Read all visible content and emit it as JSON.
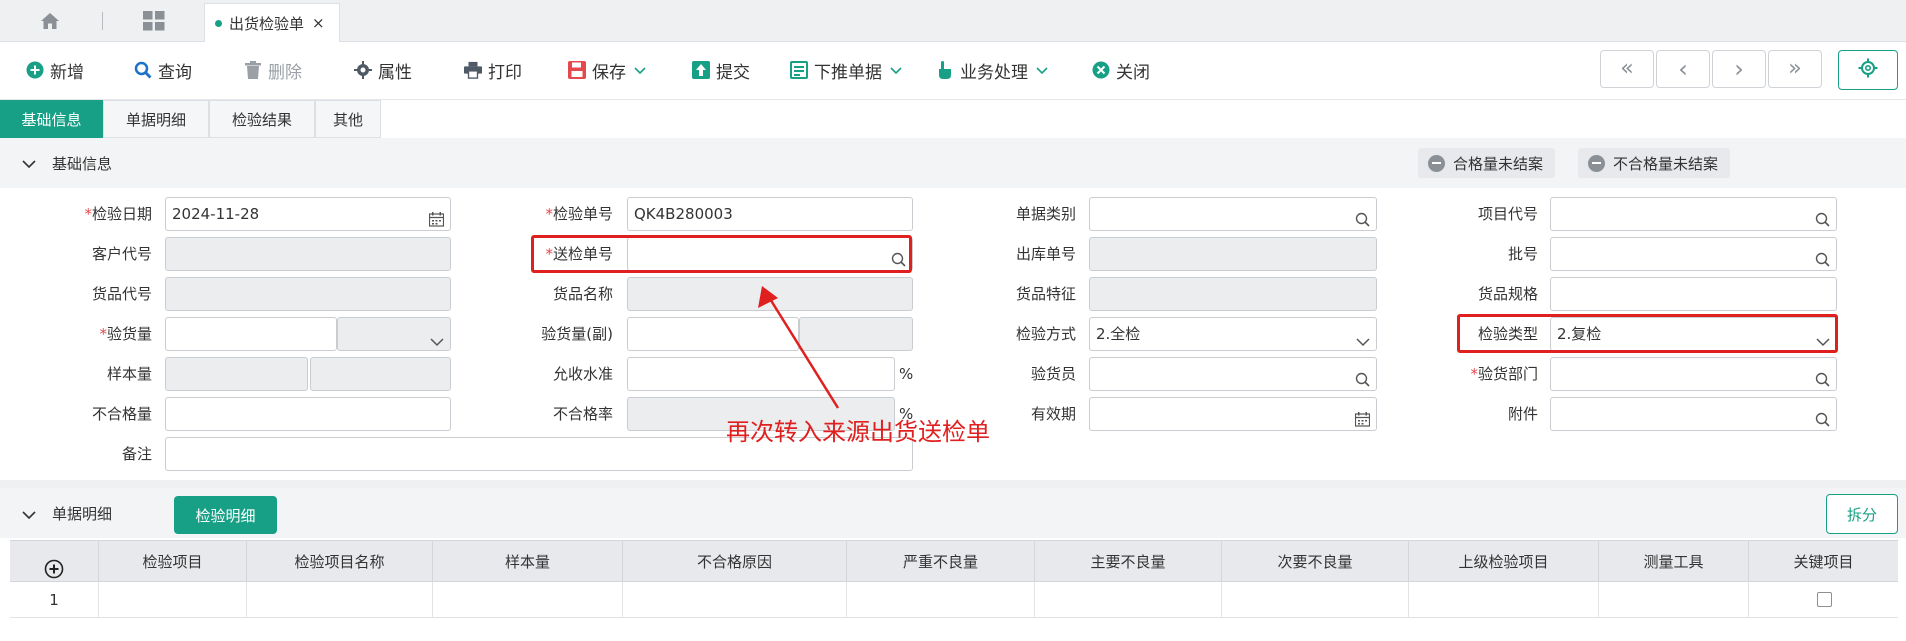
{
  "tabbar": {
    "doc_tab_label": "出货检验单",
    "close_glyph": "×"
  },
  "toolbar": {
    "new": "新增",
    "query": "查询",
    "delete": "删除",
    "props": "属性",
    "print": "打印",
    "save": "保存",
    "submit": "提交",
    "push": "下推单据",
    "business": "业务处理",
    "close": "关闭",
    "nav": [
      "«",
      "‹",
      "›",
      "»"
    ]
  },
  "sections": {
    "tabs": [
      "基础信息",
      "单据明细",
      "检验结果",
      "其他"
    ],
    "active_tab": "基础信息"
  },
  "base_info": {
    "title": "基础信息",
    "qualified_open": "合格量未结案",
    "unqualified_open": "不合格量未结案"
  },
  "form": {
    "inspect_date": {
      "label": "检验日期",
      "value": "2024-11-28"
    },
    "inspect_no": {
      "label": "检验单号",
      "value": "QK4B280003"
    },
    "doc_type": {
      "label": "单据类别",
      "value": ""
    },
    "project_code": {
      "label": "项目代号",
      "value": ""
    },
    "customer_code": {
      "label": "客户代号",
      "value": ""
    },
    "send_no": {
      "label": "送检单号",
      "value": ""
    },
    "outbound_no": {
      "label": "出库单号",
      "value": ""
    },
    "batch_no": {
      "label": "批号",
      "value": ""
    },
    "goods_code": {
      "label": "货品代号",
      "value": ""
    },
    "goods_name": {
      "label": "货品名称",
      "value": ""
    },
    "goods_feature": {
      "label": "货品特征",
      "value": ""
    },
    "goods_spec": {
      "label": "货品规格",
      "value": ""
    },
    "inspect_qty": {
      "label": "验货量",
      "value": ""
    },
    "inspect_qty_sub": {
      "label": "验货量(副)",
      "value": ""
    },
    "inspect_method": {
      "label": "检验方式",
      "value": "2.全检"
    },
    "inspect_type": {
      "label": "检验类型",
      "value": "2.复检"
    },
    "sample_qty": {
      "label": "样本量",
      "value": ""
    },
    "accept_level": {
      "label": "允收水准",
      "value": "",
      "unit": "%"
    },
    "inspector": {
      "label": "验货员",
      "value": ""
    },
    "inspect_dept": {
      "label": "验货部门",
      "value": ""
    },
    "unqualified_qty": {
      "label": "不合格量",
      "value": ""
    },
    "unqualified_rate": {
      "label": "不合格率",
      "value": "",
      "unit": "%"
    },
    "valid_period": {
      "label": "有效期",
      "value": ""
    },
    "attachment": {
      "label": "附件",
      "value": ""
    },
    "remark": {
      "label": "备注",
      "value": ""
    }
  },
  "annotation": {
    "text": "再次转入来源出货送检单",
    "color": "#e0201f"
  },
  "detail": {
    "title": "单据明细",
    "detail_btn": "检验明细",
    "split_btn": "拆分",
    "columns": [
      "检验项目",
      "检验项目名称",
      "样本量",
      "不合格原因",
      "严重不良量",
      "主要不良量",
      "次要不良量",
      "上级检验项目",
      "测量工具",
      "关键项目"
    ],
    "rows": [
      {
        "index": "1"
      }
    ]
  },
  "colors": {
    "accent": "#17a085",
    "highlight": "#e0201f"
  }
}
